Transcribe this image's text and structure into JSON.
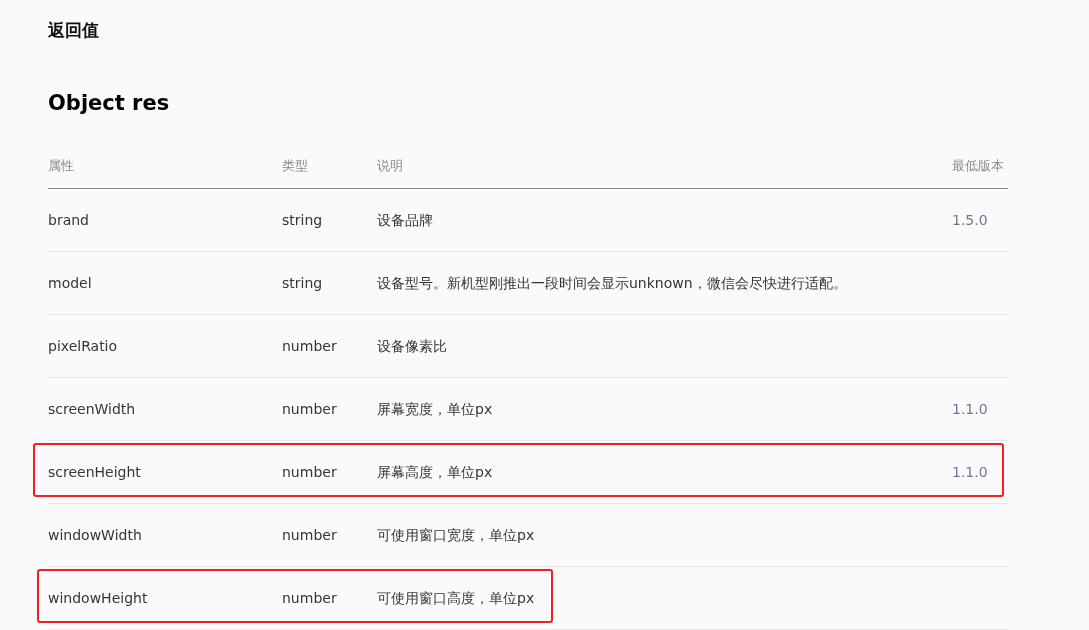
{
  "section_title": "返回值",
  "object_title": "Object res",
  "table": {
    "columns": [
      "属性",
      "类型",
      "说明",
      "最低版本"
    ],
    "rows": [
      {
        "property": "brand",
        "type": "string",
        "description": "设备品牌",
        "min_version": "1.5.0",
        "highlighted": false
      },
      {
        "property": "model",
        "type": "string",
        "description": "设备型号。新机型刚推出一段时间会显示unknown，微信会尽快进行适配。",
        "highlighted": false
      },
      {
        "property": "pixelRatio",
        "type": "number",
        "description": "设备像素比",
        "highlighted": false
      },
      {
        "property": "screenWidth",
        "type": "number",
        "description": "屏幕宽度，单位px",
        "min_version": "1.1.0",
        "highlighted": false
      },
      {
        "property": "screenHeight",
        "type": "number",
        "description": "屏幕高度，单位px",
        "min_version": "1.1.0",
        "highlighted": true,
        "highlight_spans_row": true
      },
      {
        "property": "windowWidth",
        "type": "number",
        "description": "可使用窗口宽度，单位px",
        "highlighted": false
      },
      {
        "property": "windowHeight",
        "type": "number",
        "description": "可使用窗口高度，单位px",
        "highlighted": true,
        "highlight_spans_row": false
      }
    ]
  }
}
